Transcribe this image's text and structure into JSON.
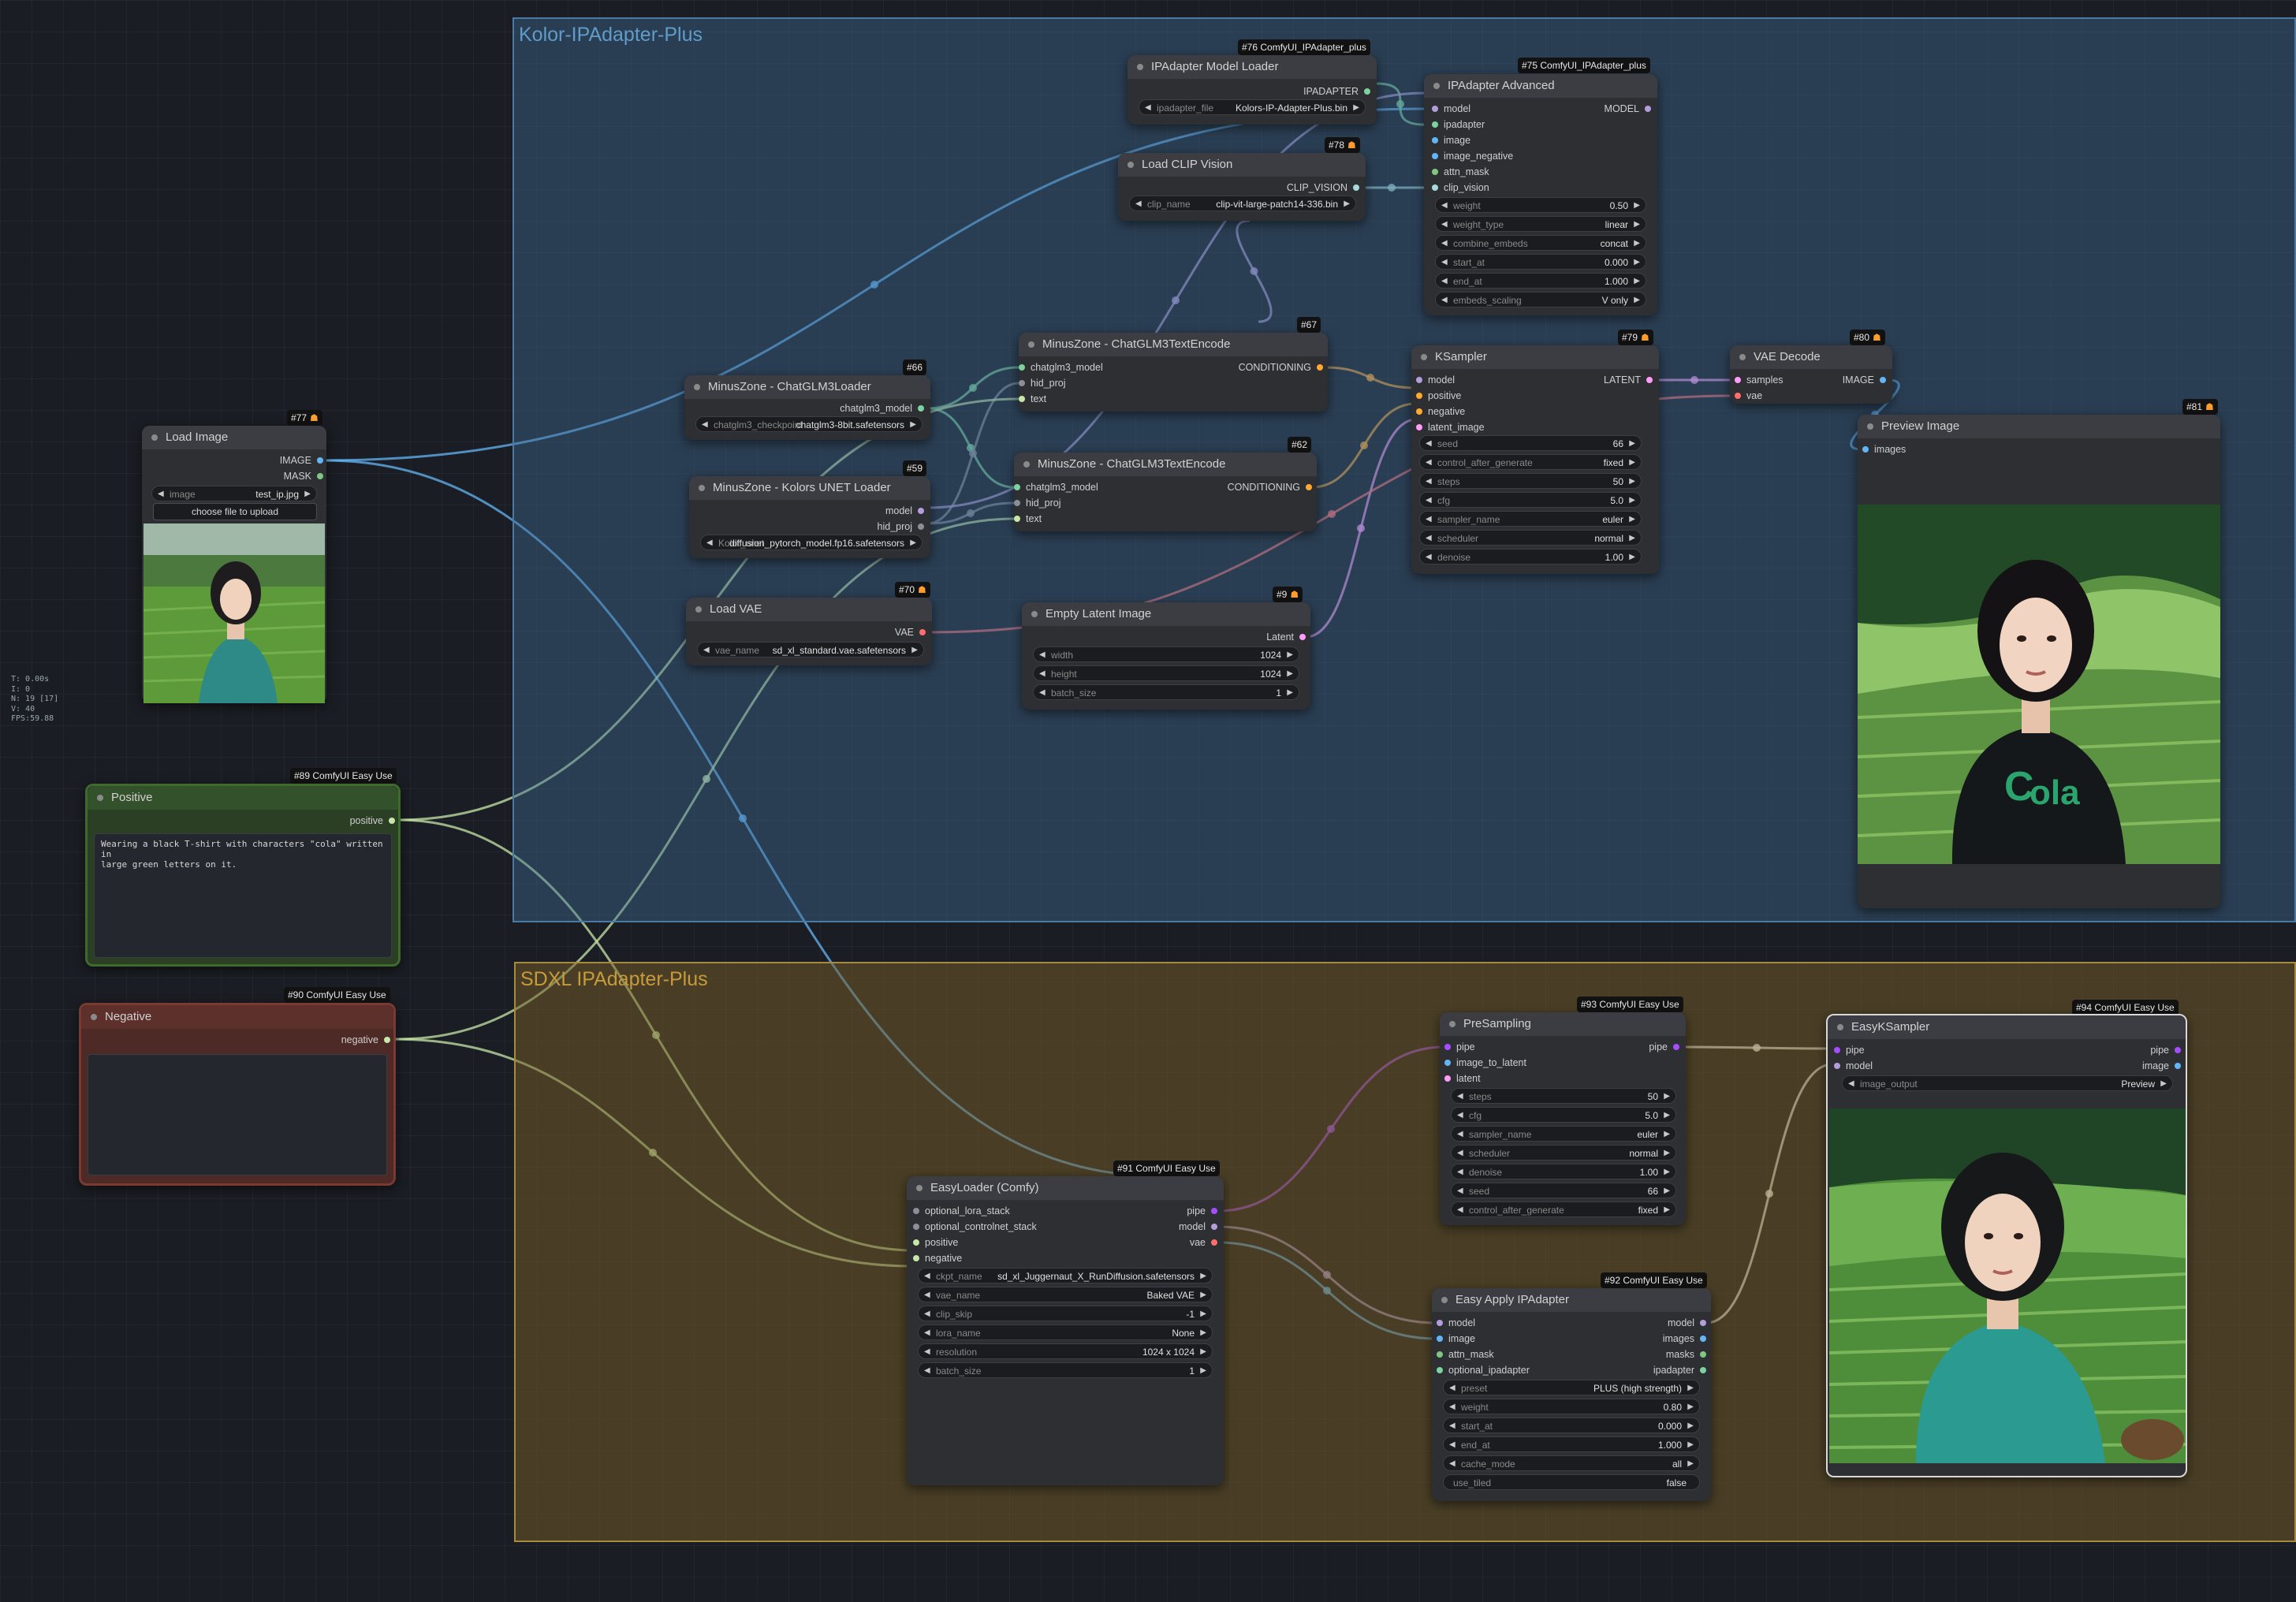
{
  "groups": {
    "kolor": {
      "title": "Kolor-IPAdapter-Plus",
      "color": "#3f789e"
    },
    "sdxl": {
      "title": "SDXL IPAdapter-Plus",
      "color": "#b58b2a"
    }
  },
  "stats": [
    "T: 0.00s",
    "I: 0",
    "N: 19 [17]",
    "V: 40",
    "FPS:59.88"
  ],
  "nodes": {
    "ipadapter_model_loader": {
      "title": "IPAdapter Model Loader",
      "badge": "#76 ComfyUI_IPAdapter_plus",
      "outputs": [
        "IPADAPTER"
      ],
      "widgets": {
        "ipadapter_file": {
          "label": "ipadapter_file",
          "value": "Kolors-IP-Adapter-Plus.bin"
        }
      }
    },
    "ipadapter_advanced": {
      "title": "IPAdapter Advanced",
      "badge": "#75 ComfyUI_IPAdapter_plus",
      "inputs": [
        "model",
        "ipadapter",
        "image",
        "image_negative",
        "attn_mask",
        "clip_vision"
      ],
      "outputs": [
        "MODEL"
      ],
      "widgets": [
        {
          "label": "weight",
          "value": "0.50"
        },
        {
          "label": "weight_type",
          "value": "linear"
        },
        {
          "label": "combine_embeds",
          "value": "concat"
        },
        {
          "label": "start_at",
          "value": "0.000"
        },
        {
          "label": "end_at",
          "value": "1.000"
        },
        {
          "label": "embeds_scaling",
          "value": "V only"
        }
      ]
    },
    "load_clip_vision": {
      "title": "Load CLIP Vision",
      "badge": "#78",
      "outputs": [
        "CLIP_VISION"
      ],
      "widgets": {
        "clip_name": {
          "label": "clip_name",
          "value": "clip-vit-large-patch14-336.bin"
        }
      }
    },
    "chatglm3_loader": {
      "title": "MinusZone - ChatGLM3Loader",
      "badge": "#66",
      "outputs": [
        "chatglm3_model"
      ],
      "widgets": {
        "checkpoint": {
          "label": "chatglm3_checkpoint",
          "value": "chatglm3-8bit.safetensors"
        }
      }
    },
    "encode_pos": {
      "title": "MinusZone - ChatGLM3TextEncode",
      "badge": "#67",
      "inputs": [
        "chatglm3_model",
        "hid_proj",
        "text"
      ],
      "outputs": [
        "CONDITIONING"
      ]
    },
    "encode_neg": {
      "title": "MinusZone - ChatGLM3TextEncode",
      "badge": "#62",
      "inputs": [
        "chatglm3_model",
        "hid_proj",
        "text"
      ],
      "outputs": [
        "CONDITIONING"
      ]
    },
    "kolors_unet": {
      "title": "MinusZone - Kolors UNET Loader",
      "badge": "#59",
      "outputs": [
        "model",
        "hid_proj"
      ],
      "widgets": {
        "unet": {
          "label": "Kolor_unet",
          "value": "diffusion_pytorch_model.fp16.safetensors"
        }
      }
    },
    "load_image": {
      "title": "Load Image",
      "badge": "#77",
      "outputs": [
        "IMAGE",
        "MASK"
      ],
      "widgets": {
        "image": {
          "label": "image",
          "value": "test_ip.jpg"
        }
      },
      "upload": "choose file to upload"
    },
    "load_vae": {
      "title": "Load VAE",
      "badge": "#70",
      "outputs": [
        "VAE"
      ],
      "widgets": {
        "vae": {
          "label": "vae_name",
          "value": "sd_xl_standard.vae.safetensors"
        }
      }
    },
    "empty_latent": {
      "title": "Empty Latent Image",
      "badge": "#9",
      "outputs": [
        "Latent"
      ],
      "widgets": [
        {
          "label": "width",
          "value": "1024"
        },
        {
          "label": "height",
          "value": "1024"
        },
        {
          "label": "batch_size",
          "value": "1"
        }
      ]
    },
    "ksampler": {
      "title": "KSampler",
      "badge": "#79",
      "inputs": [
        "model",
        "positive",
        "negative",
        "latent_image"
      ],
      "outputs": [
        "LATENT"
      ],
      "widgets": [
        {
          "label": "seed",
          "value": "66"
        },
        {
          "label": "control_after_generate",
          "value": "fixed"
        },
        {
          "label": "steps",
          "value": "50"
        },
        {
          "label": "cfg",
          "value": "5.0"
        },
        {
          "label": "sampler_name",
          "value": "euler"
        },
        {
          "label": "scheduler",
          "value": "normal"
        },
        {
          "label": "denoise",
          "value": "1.00"
        }
      ]
    },
    "vae_decode": {
      "title": "VAE Decode",
      "badge": "#80",
      "inputs": [
        "samples",
        "vae"
      ],
      "outputs": [
        "IMAGE"
      ]
    },
    "preview_image": {
      "title": "Preview Image",
      "badge": "#81",
      "inputs": [
        "images"
      ]
    },
    "positive": {
      "title": "Positive",
      "badge": "#89 ComfyUI Easy Use",
      "outputs": [
        "positive"
      ],
      "text": "Wearing a black T-shirt with characters \"cola\" written in\nlarge green letters on it."
    },
    "negative": {
      "title": "Negative",
      "badge": "#90 ComfyUI Easy Use",
      "outputs": [
        "negative"
      ],
      "text": ""
    },
    "easy_loader": {
      "title": "EasyLoader (Comfy)",
      "badge": "#91 ComfyUI Easy Use",
      "inputs": [
        "optional_lora_stack",
        "optional_controlnet_stack",
        "positive",
        "negative"
      ],
      "outputs": [
        "pipe",
        "model",
        "vae"
      ],
      "widgets": [
        {
          "label": "ckpt_name",
          "value": "sd_xl_Juggernaut_X_RunDiffusion.safetensors"
        },
        {
          "label": "vae_name",
          "value": "Baked VAE"
        },
        {
          "label": "clip_skip",
          "value": "-1"
        },
        {
          "label": "lora_name",
          "value": "None"
        },
        {
          "label": "resolution",
          "value": "1024 x 1024"
        },
        {
          "label": "batch_size",
          "value": "1"
        }
      ]
    },
    "presampling": {
      "title": "PreSampling",
      "badge": "#93 ComfyUI Easy Use",
      "inputs": [
        "pipe",
        "image_to_latent",
        "latent"
      ],
      "outputs": [
        "pipe"
      ],
      "widgets": [
        {
          "label": "steps",
          "value": "50"
        },
        {
          "label": "cfg",
          "value": "5.0"
        },
        {
          "label": "sampler_name",
          "value": "euler"
        },
        {
          "label": "scheduler",
          "value": "normal"
        },
        {
          "label": "denoise",
          "value": "1.00"
        },
        {
          "label": "seed",
          "value": "66"
        },
        {
          "label": "control_after_generate",
          "value": "fixed"
        }
      ]
    },
    "easy_apply_ipadapter": {
      "title": "Easy Apply IPAdapter",
      "badge": "#92 ComfyUI Easy Use",
      "inputs": [
        "model",
        "image",
        "attn_mask",
        "optional_ipadapter"
      ],
      "outputs": [
        "model",
        "images",
        "masks",
        "ipadapter"
      ],
      "widgets": [
        {
          "label": "preset",
          "value": "PLUS (high strength)"
        },
        {
          "label": "weight",
          "value": "0.80"
        },
        {
          "label": "start_at",
          "value": "0.000"
        },
        {
          "label": "end_at",
          "value": "1.000"
        },
        {
          "label": "cache_mode",
          "value": "all"
        }
      ],
      "toggle": {
        "label": "use_tiled",
        "value": "false"
      }
    },
    "easy_ksampler": {
      "title": "EasyKSampler",
      "badge": "#94 ComfyUI Easy Use",
      "inputs": [
        "pipe",
        "model"
      ],
      "outputs": [
        "pipe",
        "image"
      ],
      "widgets": [
        {
          "label": "image_output",
          "value": "Preview"
        }
      ]
    }
  },
  "colors": {
    "image": "#64b5f6",
    "mask": "#81c784",
    "model": "#b39ddb",
    "clip_vision": "#a8dadc",
    "conditioning": "#ffa931",
    "latent": "#ff9cf9",
    "vae": "#ff6e6e",
    "pipe": "#7737aa",
    "positive": "#c7e6a8",
    "ipadapter": "#7dd3a0",
    "generic": "#8a8f98"
  }
}
